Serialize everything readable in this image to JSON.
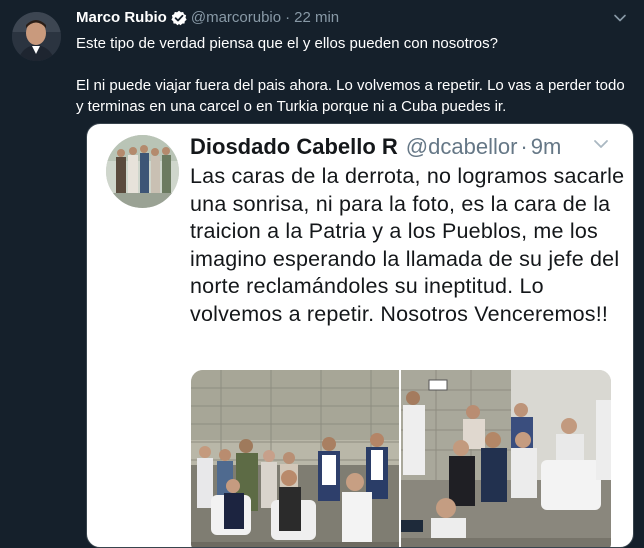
{
  "tweet": {
    "author_name": "Marco Rubio",
    "author_handle": "@marcorubio",
    "separator": "·",
    "time": "22 min",
    "paragraph_1": "Este tipo de verdad piensa que el y ellos pueden con nosotros?",
    "paragraph_2": "El ni puede viajar fuera del pais ahora. Lo volvemos a repetir. Lo vas a perder todo y terminas en una carcel o en Turkia porque ni a Cuba puedes ir."
  },
  "embedded": {
    "author_name": "Diosdado Cabello R",
    "author_handle": "@dcabellor",
    "separator": "·",
    "time": "9m",
    "text": "Las caras de la derrota, no logramos sacarle una sonrisa, ni para la foto, es la cara de la traicion a la Patria y a los Pueblos, me los imagino esperando la llamada de su jefe del norte reclamándoles su ineptitud. Lo volvemos a repetir. Nosotros Venceremos!!"
  },
  "colors": {
    "background": "#15202b",
    "secondary_text": "#8899a6",
    "verified_badge": "#ffffff",
    "embedded_background": "#ffffff"
  },
  "icons": [
    "verified-icon",
    "caret-down-icon"
  ]
}
